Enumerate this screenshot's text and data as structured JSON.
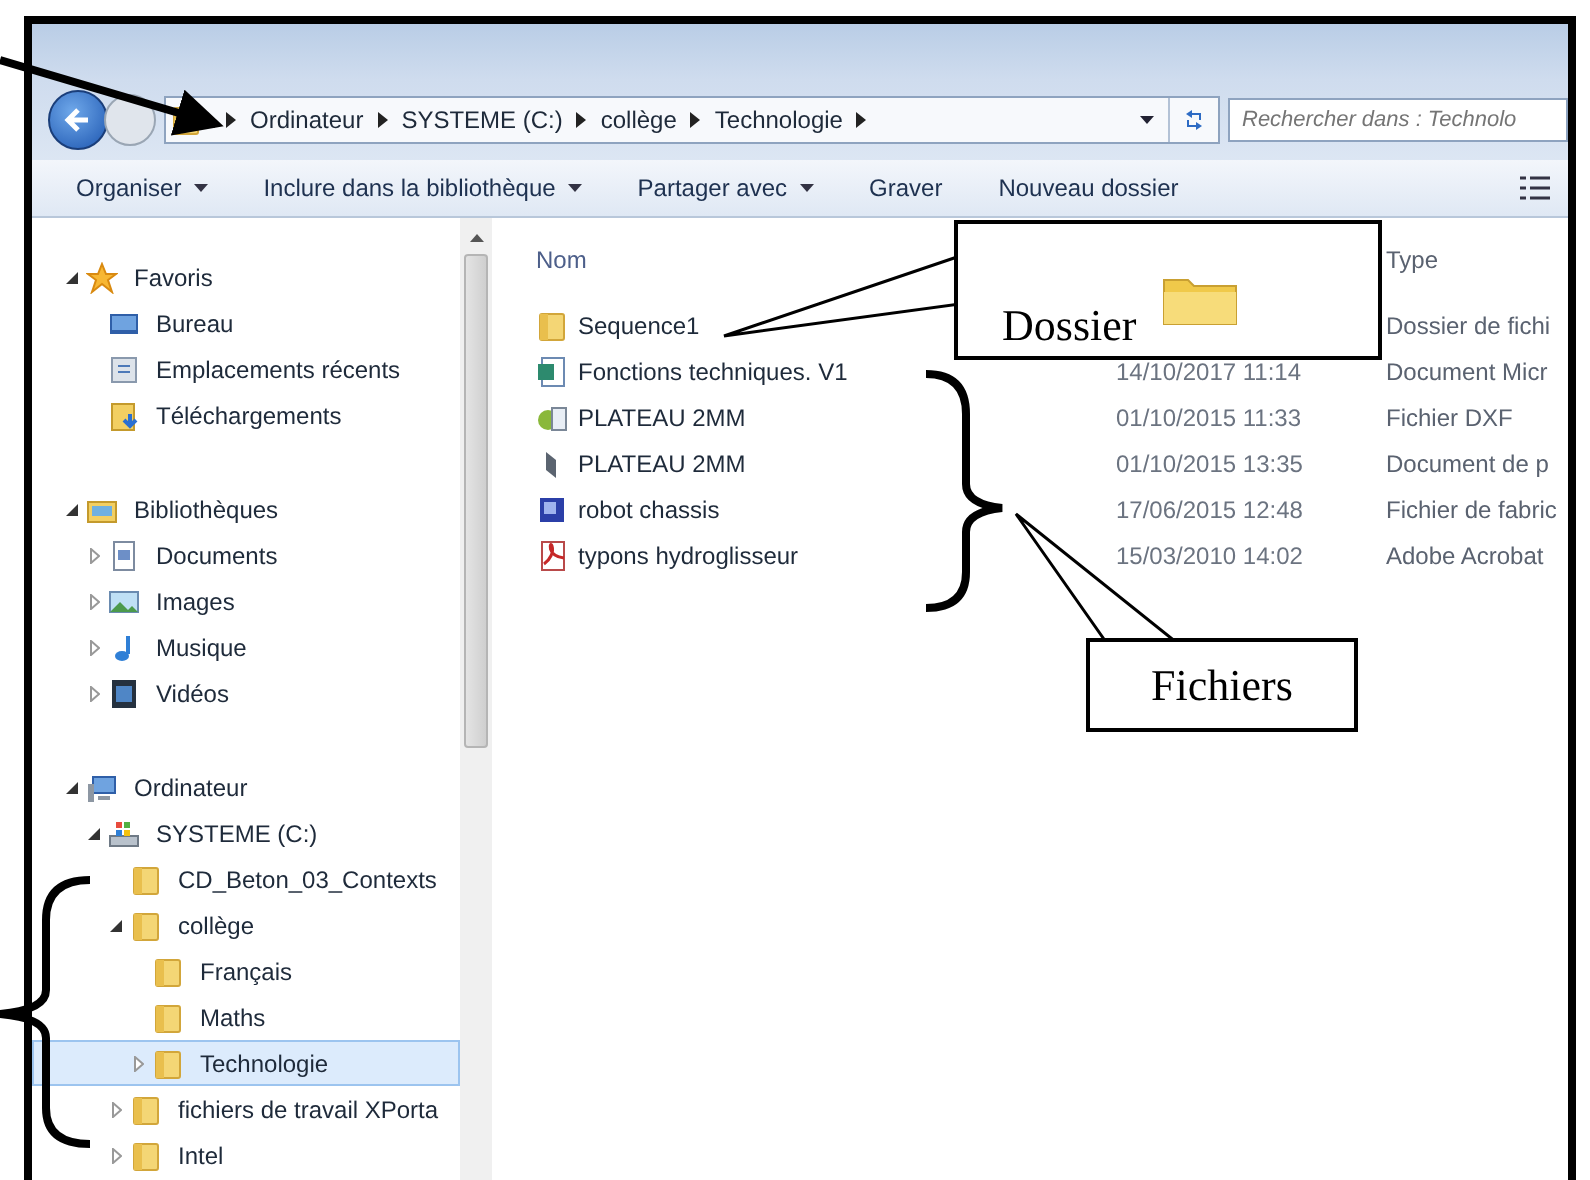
{
  "address_bar": {
    "segments": [
      "Ordinateur",
      "SYSTEME (C:)",
      "collège",
      "Technologie"
    ]
  },
  "search": {
    "placeholder": "Rechercher dans : Technolo"
  },
  "toolbar": [
    {
      "label": "Organiser",
      "dropdown": true
    },
    {
      "label": "Inclure dans la bibliothèque",
      "dropdown": true
    },
    {
      "label": "Partager avec",
      "dropdown": true
    },
    {
      "label": "Graver",
      "dropdown": false
    },
    {
      "label": "Nouveau dossier",
      "dropdown": false
    }
  ],
  "sidebar": {
    "tree": [
      {
        "label": "Favoris",
        "kind": "star",
        "expanded": true,
        "selected": false,
        "children": [
          {
            "label": "Bureau",
            "kind": "desktop",
            "selected": false
          },
          {
            "label": "Emplacements récents",
            "kind": "recent",
            "selected": false
          },
          {
            "label": "Téléchargements",
            "kind": "download",
            "selected": false
          }
        ]
      },
      {
        "label": "Bibliothèques",
        "kind": "library",
        "expanded": true,
        "selected": false,
        "children": [
          {
            "label": "Documents",
            "kind": "document",
            "expanded": false,
            "selected": false
          },
          {
            "label": "Images",
            "kind": "image",
            "expanded": false,
            "selected": false
          },
          {
            "label": "Musique",
            "kind": "music",
            "expanded": false,
            "selected": false
          },
          {
            "label": "Vidéos",
            "kind": "video",
            "expanded": false,
            "selected": false
          }
        ]
      },
      {
        "label": "Ordinateur",
        "kind": "computer",
        "expanded": true,
        "selected": false,
        "children": [
          {
            "label": "SYSTEME (C:)",
            "kind": "drive",
            "expanded": true,
            "selected": false,
            "children": [
              {
                "label": "CD_Beton_03_Contexts",
                "kind": "folder",
                "selected": false
              },
              {
                "label": "collège",
                "kind": "folder",
                "expanded": true,
                "selected": false,
                "children": [
                  {
                    "label": "Français",
                    "kind": "folder",
                    "selected": false
                  },
                  {
                    "label": "Maths",
                    "kind": "folder",
                    "selected": false
                  },
                  {
                    "label": "Technologie",
                    "kind": "folder",
                    "expanded": false,
                    "selected": true
                  }
                ]
              },
              {
                "label": "fichiers de travail XPorta",
                "kind": "folder",
                "expanded": false,
                "selected": false
              },
              {
                "label": "Intel",
                "kind": "folder",
                "expanded": false,
                "selected": false
              }
            ]
          }
        ]
      }
    ]
  },
  "files": {
    "columns": [
      "Nom",
      "Type"
    ],
    "rows": [
      {
        "name": "Sequence1",
        "kind": "folder",
        "type": "Dossier de fichi"
      },
      {
        "name": "Fonctions techniques. V1",
        "kind": "word",
        "date": "14/10/2017 11:14",
        "type": "Document Micr"
      },
      {
        "name": "PLATEAU 2MM",
        "kind": "dxf",
        "date": "01/10/2015 11:33",
        "type": "Fichier DXF"
      },
      {
        "name": "PLATEAU 2MM",
        "kind": "part",
        "date": "01/10/2015 13:35",
        "type": "Document de p"
      },
      {
        "name": "robot chassis",
        "kind": "fab",
        "date": "17/06/2015 12:48",
        "type": "Fichier de fabric"
      },
      {
        "name": "typons hydroglisseur",
        "kind": "pdf",
        "date": "15/03/2010 14:02",
        "type": "Adobe Acrobat"
      }
    ]
  },
  "annotations": {
    "folder_callout": "Dossier",
    "files_callout": "Fichiers"
  }
}
